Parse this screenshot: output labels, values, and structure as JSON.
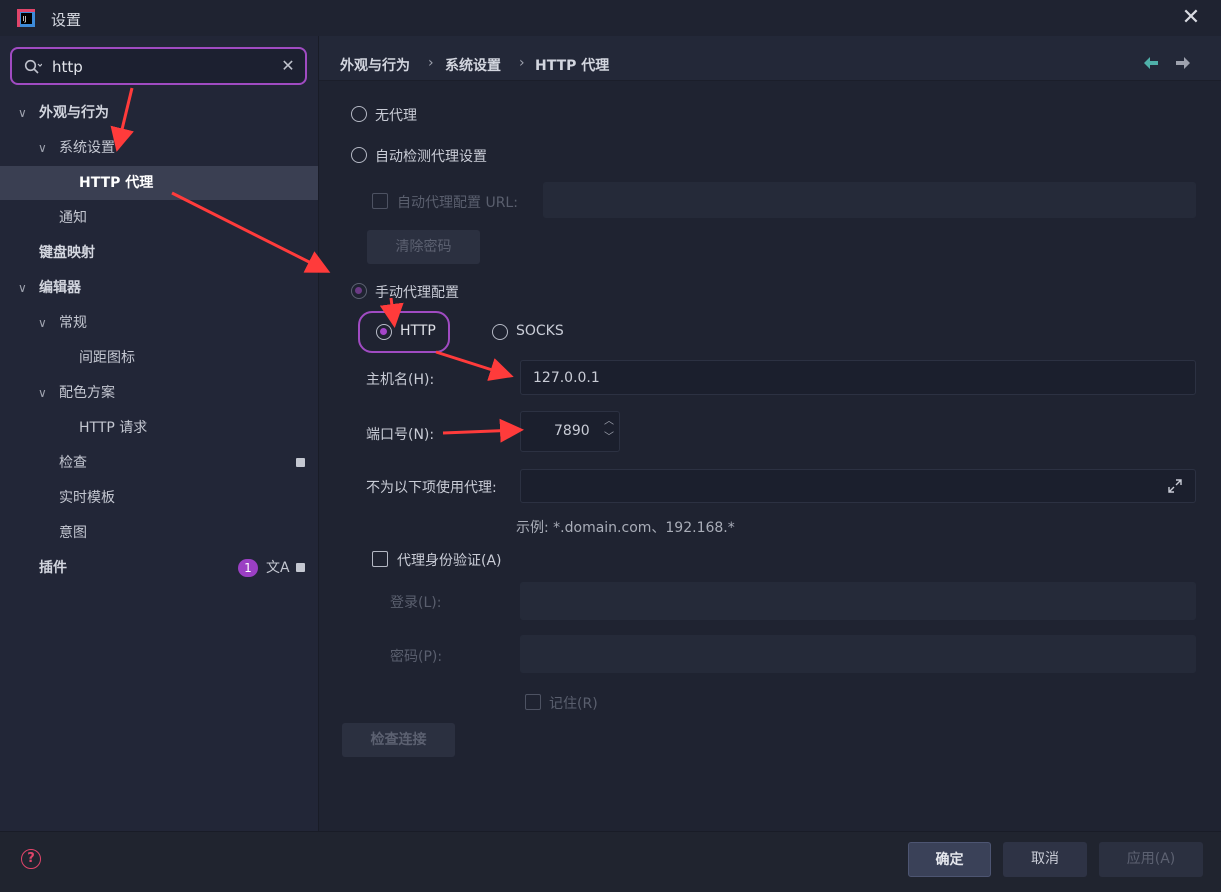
{
  "window": {
    "title": "设置",
    "close_glyph": "✕"
  },
  "search": {
    "value": "http",
    "clear_glyph": "✕"
  },
  "sidebar": {
    "items": [
      {
        "label": "外观与行为",
        "expanded": true
      },
      {
        "label": "系统设置",
        "expanded": true
      },
      {
        "label": "HTTP 代理",
        "selected": true
      },
      {
        "label": "通知"
      },
      {
        "label": "键盘映射"
      },
      {
        "label": "编辑器",
        "expanded": true
      },
      {
        "label": "常规",
        "expanded": true
      },
      {
        "label": "间距图标"
      },
      {
        "label": "配色方案",
        "expanded": true
      },
      {
        "label": "HTTP 请求"
      },
      {
        "label": "检查"
      },
      {
        "label": "实时模板"
      },
      {
        "label": "意图"
      },
      {
        "label": "插件",
        "badge": "1"
      }
    ],
    "plugin_badge": "1",
    "translate_glyph": "文A"
  },
  "breadcrumb": {
    "items": [
      "外观与行为",
      "系统设置",
      "HTTP 代理"
    ],
    "separator": "›"
  },
  "proxy": {
    "no_proxy": "无代理",
    "auto_detect": "自动检测代理设置",
    "auto_config_url_label": "自动代理配置 URL:",
    "clear_password": "清除密码",
    "manual": "手动代理配置",
    "http": "HTTP",
    "socks": "SOCKS",
    "host_label": "主机名(H):",
    "host_value": "127.0.0.1",
    "port_label": "端口号(N):",
    "port_value": "7890",
    "no_proxy_for_label": "不为以下项使用代理:",
    "example": "示例: *.domain.com、192.168.*",
    "auth_label": "代理身份验证(A)",
    "login_label": "登录(L):",
    "password_label": "密码(P):",
    "remember_label": "记住(R)",
    "check_connection": "检查连接",
    "selected_mode": "manual",
    "selected_type": "HTTP"
  },
  "footer": {
    "ok": "确定",
    "cancel": "取消",
    "apply": "应用(A)",
    "help_glyph": "?"
  },
  "colors": {
    "accent": "#a445c9",
    "highlight": "#a04bc2",
    "annotation": "#ff3b3b",
    "back_arrow": "#4fb0a9"
  }
}
